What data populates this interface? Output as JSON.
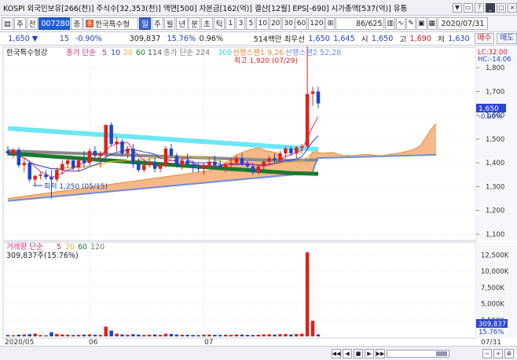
{
  "header": {
    "info": "KOSPI 외국인보유[266(천)] 주식수[32,353(천)] 액면[500] 자본금[162(억)] 결산[12월] EPS[-690] 시가총액[537(억)] 유통",
    "icons": [
      "dropdown-icon",
      "restore-icon",
      "help-icon",
      "minimize-icon",
      "maximize-icon",
      "close-icon"
    ]
  },
  "toolbar": {
    "btn_week": "주",
    "btn_prev": "전",
    "code": "007280",
    "btn_search": "종",
    "stock_name": "한국특수형",
    "mark": "",
    "period": [
      "일",
      "주",
      "월",
      "년",
      "분",
      "초",
      "틱"
    ],
    "period_selected": "일",
    "minutes": [
      "1",
      "3",
      "5",
      "10",
      "20",
      "30",
      "60",
      "120"
    ],
    "count": "86/625",
    "date": "2020/07/31"
  },
  "quote": {
    "price": "1,650",
    "arrow": "▼",
    "change": "15",
    "change_pct": "-0.90%",
    "volume": "309,837",
    "vol_ratio": "15.76%",
    "turnover": "0.96%",
    "amount": "514백만",
    "best_ask_label": "최우선",
    "best_ask": "1,650",
    "best_bid": "1,645",
    "open_label": "시",
    "open": "1,650",
    "high_label": "고",
    "high": "1,690",
    "low_label": "저",
    "low": "1,630",
    "buy_label": "매수",
    "sell_label": "매도"
  },
  "price_panel": {
    "legend_stock": "한국특수형강",
    "legend_ma": "종가 단순",
    "ma_periods": [
      "5",
      "10",
      "20",
      "60",
      "114"
    ],
    "legend_ichimoku": "종가 단순 224",
    "ichimoku_val": "300",
    "lead1": "선행스팬1 9,26",
    "lead2": "선행스팬2 52,26",
    "annot_high": "최고 1,920 (07/29)",
    "annot_low": "최저 1,250 (05/15)",
    "lc": "LC:32.00",
    "hc": "HC:-14.06",
    "last_price": "1,650",
    "last_pct": "-0.90%",
    "y_ticks": [
      "1,800",
      "1,700",
      "1,600",
      "1,500",
      "1,400",
      "1,300",
      "1,200",
      "1,100"
    ]
  },
  "volume_panel": {
    "legend": "거래량 단순",
    "ma_periods": [
      "5",
      "20",
      "60",
      "120"
    ],
    "current": "309,837주(15.76%)",
    "last_vol": "309,837",
    "last_pct": "15.76%",
    "y_ticks": [
      "12,500K",
      "10,000K",
      "7,500K",
      "5,000K",
      "2,500K"
    ]
  },
  "x_axis": [
    "2020/05",
    "06",
    "07",
    "07/31"
  ],
  "colors": {
    "up": "#e0201a",
    "down": "#1c46c9",
    "cloud_fill": "#f2a060",
    "cloud_dark": "#6b8de0",
    "ma5": "#d62b7a",
    "ma10": "#2b44d6",
    "ma20": "#e6b22b",
    "ma60": "#1a7a2a",
    "ma114": "#8a8a8a",
    "cyan": "#6de6f5"
  },
  "chart_data": {
    "type": "candlestick",
    "title": "",
    "stock": "한국특수형강",
    "x_labels": [
      "2020/05",
      "06",
      "07",
      "07/31"
    ],
    "y_range": [
      1080,
      1880
    ],
    "annotations": [
      {
        "label": "최고 1,920 (07/29)",
        "value": 1920,
        "date": "07/29"
      },
      {
        "label": "최저 1,250 (05/15)",
        "value": 1250,
        "date": "05/15"
      }
    ],
    "candles": [
      [
        1450,
        1470,
        1430,
        1440
      ],
      [
        1440,
        1460,
        1420,
        1455
      ],
      [
        1455,
        1465,
        1380,
        1390
      ],
      [
        1390,
        1420,
        1360,
        1400
      ],
      [
        1400,
        1410,
        1320,
        1330
      ],
      [
        1330,
        1350,
        1300,
        1345
      ],
      [
        1345,
        1360,
        1330,
        1350
      ],
      [
        1350,
        1370,
        1330,
        1340
      ],
      [
        1340,
        1370,
        1250,
        1330
      ],
      [
        1330,
        1380,
        1320,
        1370
      ],
      [
        1370,
        1410,
        1350,
        1395
      ],
      [
        1395,
        1420,
        1380,
        1410
      ],
      [
        1410,
        1420,
        1370,
        1380
      ],
      [
        1380,
        1420,
        1360,
        1410
      ],
      [
        1410,
        1450,
        1380,
        1400
      ],
      [
        1400,
        1460,
        1390,
        1450
      ],
      [
        1450,
        1470,
        1420,
        1430
      ],
      [
        1430,
        1450,
        1380,
        1440
      ],
      [
        1440,
        1560,
        1420,
        1560
      ],
      [
        1560,
        1570,
        1470,
        1480
      ],
      [
        1480,
        1510,
        1450,
        1490
      ],
      [
        1490,
        1500,
        1430,
        1440
      ],
      [
        1440,
        1470,
        1420,
        1460
      ],
      [
        1460,
        1480,
        1380,
        1395
      ],
      [
        1395,
        1420,
        1360,
        1370
      ],
      [
        1370,
        1400,
        1360,
        1390
      ],
      [
        1390,
        1420,
        1380,
        1400
      ],
      [
        1400,
        1420,
        1360,
        1375
      ],
      [
        1375,
        1400,
        1360,
        1390
      ],
      [
        1390,
        1470,
        1380,
        1460
      ],
      [
        1460,
        1480,
        1420,
        1430
      ],
      [
        1430,
        1440,
        1380,
        1390
      ],
      [
        1390,
        1420,
        1370,
        1410
      ],
      [
        1410,
        1440,
        1390,
        1395
      ],
      [
        1395,
        1410,
        1360,
        1380
      ],
      [
        1380,
        1400,
        1360,
        1375
      ],
      [
        1375,
        1400,
        1350,
        1390
      ],
      [
        1390,
        1420,
        1380,
        1405
      ],
      [
        1405,
        1430,
        1380,
        1390
      ],
      [
        1390,
        1410,
        1370,
        1380
      ],
      [
        1380,
        1400,
        1360,
        1395
      ],
      [
        1395,
        1420,
        1380,
        1400
      ],
      [
        1400,
        1430,
        1390,
        1420
      ],
      [
        1420,
        1440,
        1390,
        1395
      ],
      [
        1395,
        1410,
        1370,
        1385
      ],
      [
        1385,
        1400,
        1350,
        1360
      ],
      [
        1360,
        1390,
        1350,
        1385
      ],
      [
        1385,
        1410,
        1370,
        1405
      ],
      [
        1405,
        1430,
        1390,
        1420
      ],
      [
        1420,
        1440,
        1400,
        1410
      ],
      [
        1410,
        1450,
        1400,
        1440
      ],
      [
        1440,
        1470,
        1420,
        1460
      ],
      [
        1460,
        1470,
        1430,
        1440
      ],
      [
        1440,
        1470,
        1420,
        1465
      ],
      [
        1465,
        1480,
        1440,
        1470
      ],
      [
        1470,
        1890,
        1460,
        1690
      ],
      [
        1690,
        1720,
        1640,
        1700
      ],
      [
        1700,
        1720,
        1630,
        1650
      ]
    ],
    "volume_unit": "K",
    "volume": [
      220,
      180,
      260,
      300,
      340,
      420,
      200,
      160,
      640,
      380,
      300,
      260,
      210,
      240,
      280,
      320,
      250,
      220,
      1500,
      900,
      420,
      300,
      260,
      340,
      280,
      220,
      260,
      300,
      240,
      420,
      380,
      300,
      260,
      240,
      220,
      200,
      260,
      280,
      240,
      220,
      260,
      240,
      300,
      280,
      240,
      220,
      260,
      300,
      320,
      280,
      340,
      380,
      300,
      360,
      420,
      12900,
      2400,
      310
    ]
  }
}
